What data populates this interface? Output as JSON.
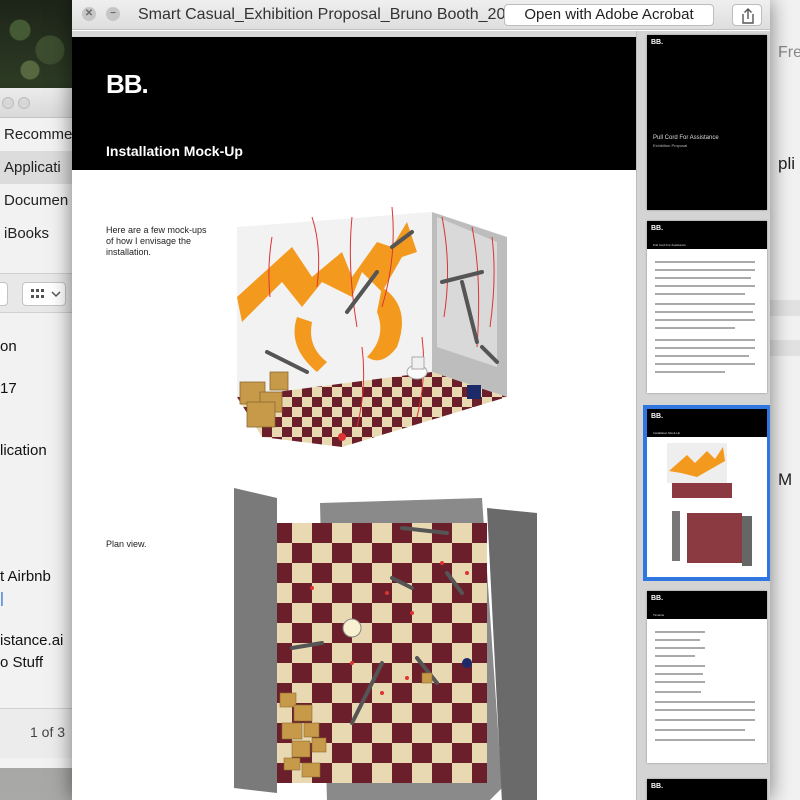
{
  "finder": {
    "sidebar_items": [
      "Recomme",
      "Applicati",
      "Documen",
      "iBooks"
    ],
    "rows": [
      "on",
      "17",
      "lication",
      "t Airbnb",
      "istance.ai",
      "o Stuff"
    ],
    "page_indicator": "1 of 3"
  },
  "right_window": {
    "title": "Fre",
    "items": [
      "pli",
      "M"
    ]
  },
  "preview": {
    "window_title": "Smart Casual_Exhibition Proposal_Bruno Booth_20...",
    "open_button": "Open with Adobe Acrobat",
    "page": {
      "logo": "BB.",
      "title": "Installation Mock-Up",
      "caption_1": "Here are a few mock-ups of how I envisage the installation.",
      "caption_2": "Plan view."
    },
    "thumbnails": [
      {
        "logo": "BB.",
        "label": "Pull Cord For Assistance",
        "sublabel": "Exhibition Proposal",
        "selected": false
      },
      {
        "logo": "BB.",
        "label": "Pull Cord For Assistance",
        "selected": false
      },
      {
        "logo": "BB.",
        "label": "Installation Mock-Up",
        "selected": true
      },
      {
        "logo": "BB.",
        "label": "Timeline",
        "selected": false
      },
      {
        "logo": "BB.",
        "selected": false
      }
    ]
  },
  "colors": {
    "accent": "#2f76e0",
    "wall_orange": "#f39a1e",
    "floor_dark": "#6a1f2a",
    "floor_light": "#e8d9b2",
    "panel_grey": "#7a7a7a"
  }
}
